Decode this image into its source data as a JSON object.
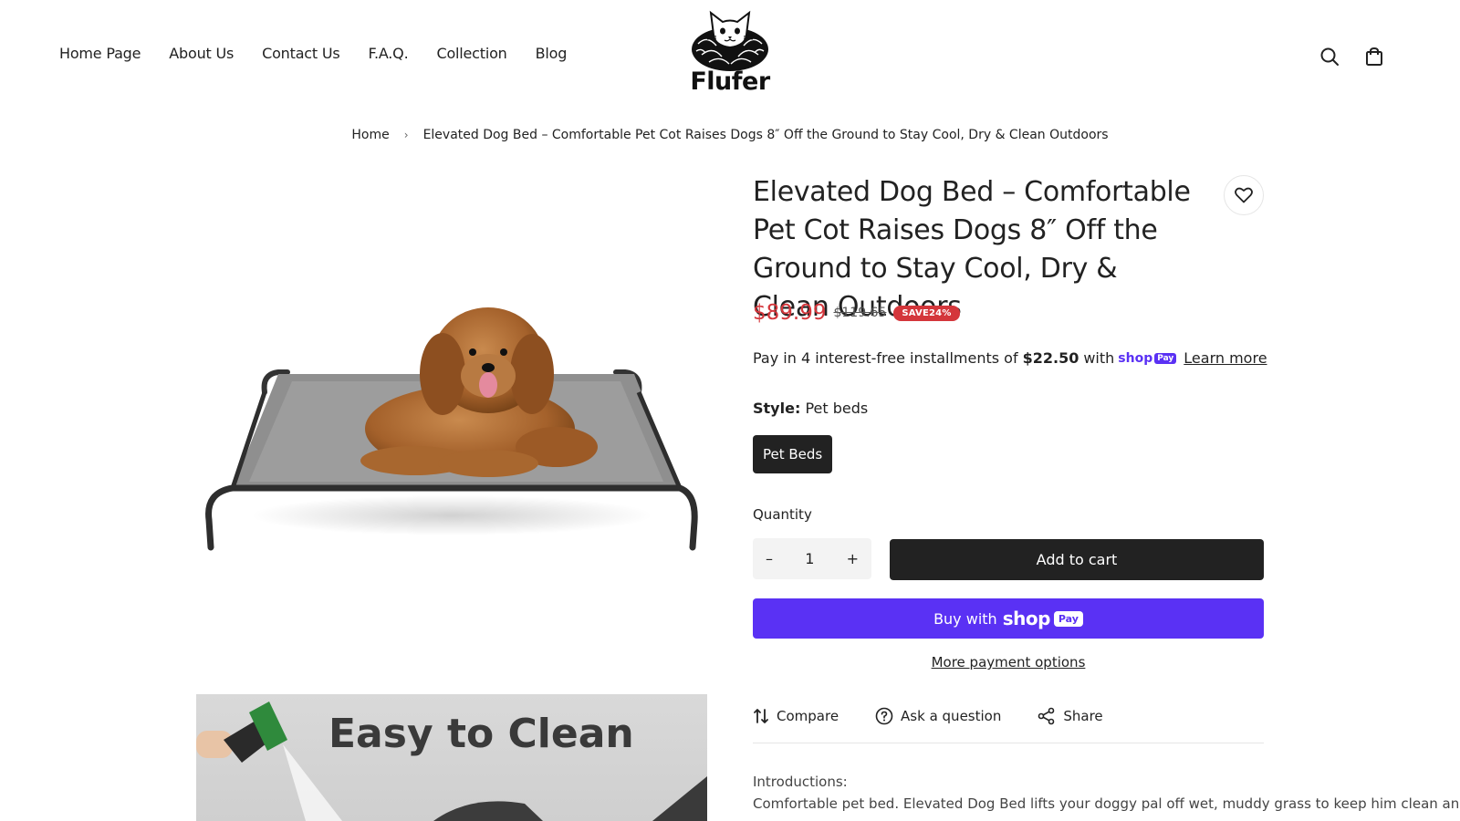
{
  "nav": {
    "items": [
      "Home Page",
      "About Us",
      "Contact Us",
      "F.A.Q.",
      "Collection",
      "Blog"
    ]
  },
  "brand": {
    "name": "Flufer"
  },
  "header_icons": [
    "search-icon",
    "shopping-bag-icon"
  ],
  "breadcrumb": {
    "home": "Home",
    "current": "Elevated Dog Bed – Comfortable Pet Cot Raises Dogs 8″ Off the Ground to Stay Cool, Dry & Clean Outdoors"
  },
  "gallery": {
    "second_image_caption": "Easy to Clean"
  },
  "product": {
    "title": "Elevated Dog Bed – Comfortable Pet Cot Raises Dogs 8″ Off the Ground to Stay Cool, Dry & Clean Outdoors",
    "price": "$89.99",
    "compare_price": "$119.65",
    "badge": "SAVE24%",
    "installments_prefix": "Pay in 4 interest-free installments of",
    "installments_amount": "$22.50",
    "installments_with": "with",
    "shoppay_mini_text": "shop",
    "shoppay_mini_pay": "Pay",
    "learn_more": "Learn more",
    "style_label": "Style:",
    "style_value": "Pet beds",
    "style_option": "Pet Beds",
    "quantity_label": "Quantity",
    "quantity_minus": "–",
    "quantity_value": "1",
    "quantity_plus": "+",
    "add_to_cart": "Add to cart",
    "buy_with": "Buy with",
    "buy_shop": "shop",
    "buy_pay": "Pay",
    "more_payment": "More payment options",
    "actions": {
      "compare": "Compare",
      "ask": "Ask a question",
      "share": "Share"
    },
    "intro_label": "Introductions:",
    "intro_text": "Comfortable pet bed. Elevated Dog Bed lifts your doggy pal off wet, muddy grass to keep him clean and cool, esp"
  },
  "colors": {
    "accent_price": "#d4363b",
    "shop_pay": "#5a31f4",
    "button_dark": "#222222"
  }
}
